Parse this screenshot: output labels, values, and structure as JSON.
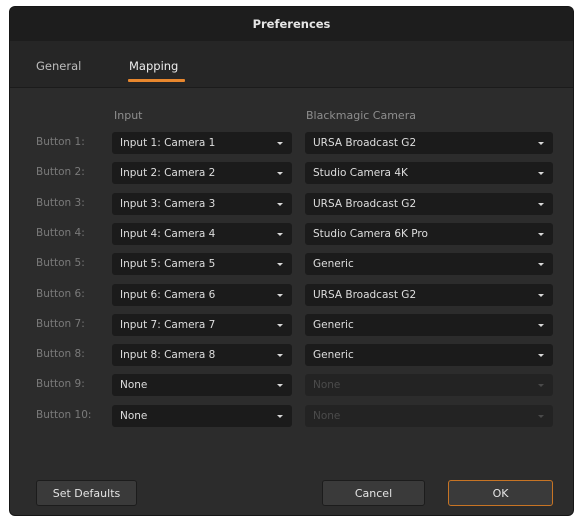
{
  "window": {
    "title": "Preferences"
  },
  "tabs": [
    {
      "label": "General",
      "active": false
    },
    {
      "label": "Mapping",
      "active": true
    }
  ],
  "columns": {
    "input": "Input",
    "camera": "Blackmagic Camera"
  },
  "rows": [
    {
      "label": "Button 1:",
      "input": "Input 1: Camera 1",
      "camera": "URSA Broadcast G2",
      "camera_enabled": true
    },
    {
      "label": "Button 2:",
      "input": "Input 2: Camera 2",
      "camera": "Studio Camera 4K",
      "camera_enabled": true
    },
    {
      "label": "Button 3:",
      "input": "Input 3: Camera 3",
      "camera": "URSA Broadcast G2",
      "camera_enabled": true
    },
    {
      "label": "Button 4:",
      "input": "Input 4: Camera 4",
      "camera": "Studio Camera 6K Pro",
      "camera_enabled": true
    },
    {
      "label": "Button 5:",
      "input": "Input 5: Camera 5",
      "camera": "Generic",
      "camera_enabled": true
    },
    {
      "label": "Button 6:",
      "input": "Input 6: Camera 6",
      "camera": "URSA Broadcast G2",
      "camera_enabled": true
    },
    {
      "label": "Button 7:",
      "input": "Input 7: Camera 7",
      "camera": "Generic",
      "camera_enabled": true
    },
    {
      "label": "Button 8:",
      "input": "Input 8: Camera 8",
      "camera": "Generic",
      "camera_enabled": true
    },
    {
      "label": "Button 9:",
      "input": "None",
      "camera": "None",
      "camera_enabled": false
    },
    {
      "label": "Button 10:",
      "input": "None",
      "camera": "None",
      "camera_enabled": false
    }
  ],
  "buttons": {
    "set_defaults": "Set Defaults",
    "cancel": "Cancel",
    "ok": "OK"
  },
  "colors": {
    "accent": "#e8872e",
    "background": "#2c2c2c",
    "dropdown": "#1b1b1b"
  }
}
